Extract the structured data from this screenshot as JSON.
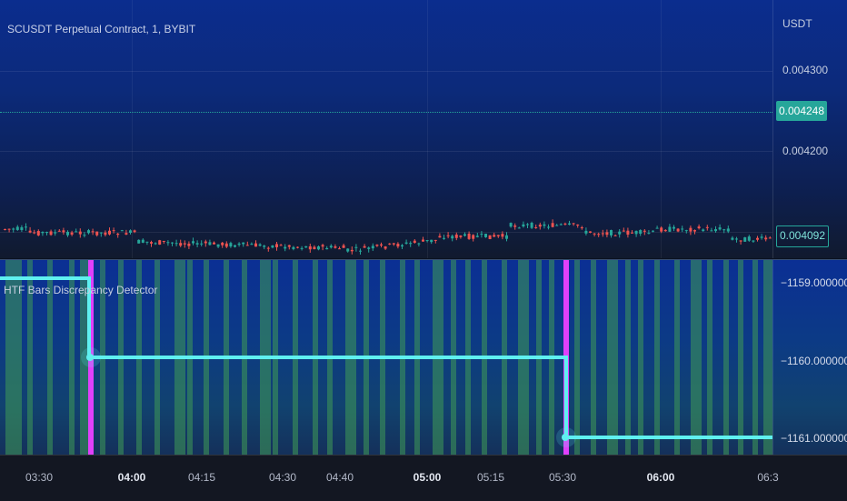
{
  "symbol": {
    "title": "SCUSDT Perpetual Contract, 1, BYBIT"
  },
  "price_scale": {
    "unit": "USDT",
    "labels": [
      "0.004300",
      "0.004200"
    ],
    "last_price": "0.004248",
    "low_price": "0.004092"
  },
  "indicator": {
    "title": "HTF Bars Discrepancy Detector",
    "scale_labels": [
      "−1159.000000",
      "−1160.000000",
      "−1161.000000"
    ]
  },
  "time_axis": {
    "labels": [
      "03:30",
      "04:00",
      "04:15",
      "04:30",
      "04:40",
      "05:00",
      "05:15",
      "05:30",
      "06:00",
      "06:3"
    ],
    "major_labels": [
      "04:00",
      "05:00",
      "06:00"
    ]
  },
  "colors": {
    "up": "#26a69a",
    "down": "#ef5350",
    "step_line": "#5ff0f0",
    "marker": "#e040fb",
    "green_band": "#3f9a55"
  }
}
